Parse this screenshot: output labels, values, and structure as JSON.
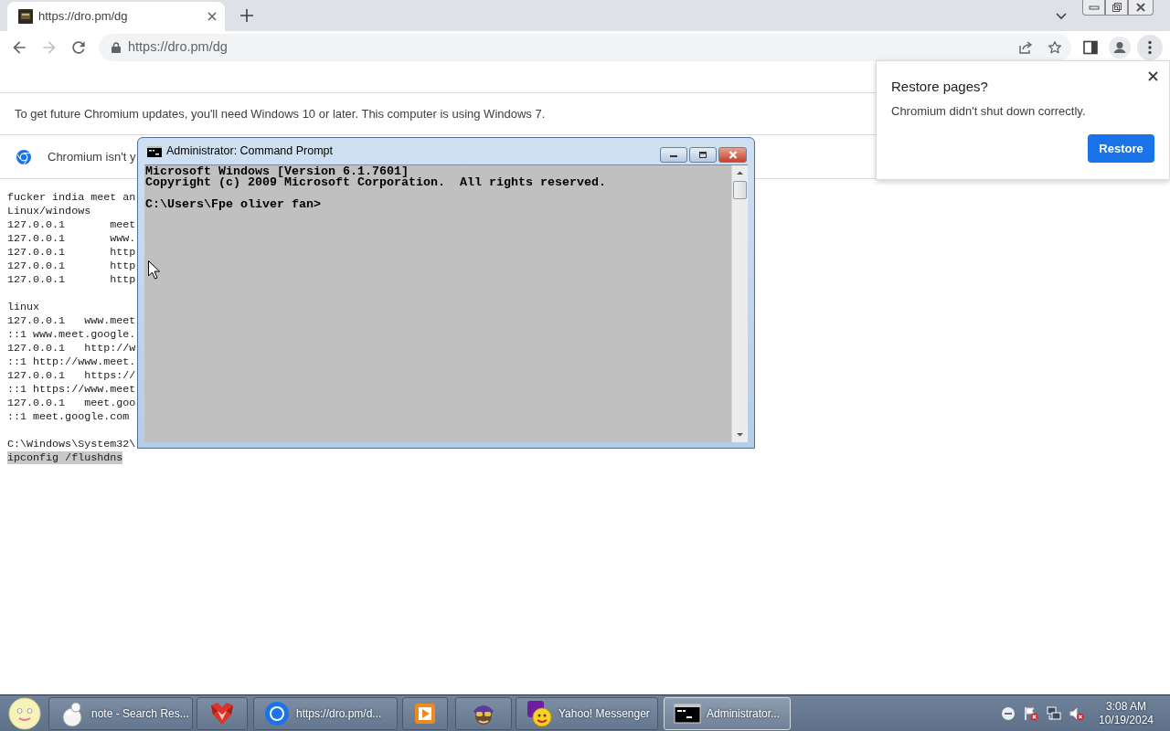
{
  "browser": {
    "tabs": [
      {
        "title": "https://dro.pm/dg",
        "selected": true
      }
    ],
    "toolbar": {
      "back": {
        "disabled": false
      },
      "forward": {
        "disabled": true
      },
      "address": "https://dro.pm/dg"
    },
    "infobars": [
      {
        "kind": "notice",
        "text": "To get future Chromium updates, you'll need Windows 10 or later. This computer is using Windows 7."
      },
      {
        "kind": "logo",
        "text": "Chromium isn't y"
      }
    ],
    "page_text": {
      "blocks": [
        {
          "lines": [
            {
              "text": "fucker india meet an",
              "selected": false
            },
            {
              "text": "Linux/windows",
              "selected": false
            },
            {
              "text": "127.0.0.1       meet",
              "selected": false
            },
            {
              "text": "127.0.0.1       www.",
              "selected": false
            },
            {
              "text": "127.0.0.1       http",
              "selected": false
            },
            {
              "text": "127.0.0.1       http",
              "selected": false
            },
            {
              "text": "127.0.0.1       http",
              "selected": false
            }
          ]
        },
        {
          "lines": [
            {
              "text": "linux",
              "selected": false
            },
            {
              "text": "127.0.0.1   www.meet",
              "selected": false
            },
            {
              "text": "::1 www.meet.google.",
              "selected": false
            },
            {
              "text": "127.0.0.1   http://w",
              "selected": false
            },
            {
              "text": "::1 http://www.meet.",
              "selected": false
            },
            {
              "text": "127.0.0.1   https://",
              "selected": false
            },
            {
              "text": "::1 https://www.meet",
              "selected": false
            },
            {
              "text": "127.0.0.1   meet.goo",
              "selected": false
            },
            {
              "text": "::1 meet.google.com",
              "selected": false
            }
          ]
        },
        {
          "lines": [
            {
              "text": "C:\\Windows\\System32\\",
              "selected": false
            },
            {
              "text": "ipconfig /flushdns",
              "selected": true
            }
          ]
        }
      ]
    },
    "restore_dialog": {
      "title": "Restore pages?",
      "message": "Chromium didn't shut down correctly.",
      "button": "Restore"
    }
  },
  "cmd_window": {
    "title": "Administrator: Command Prompt",
    "blocks": [
      [
        "Microsoft Windows [Version 6.1.7601]",
        "Copyright (c) 2009 Microsoft Corporation.  All rights reserved."
      ],
      [
        "C:\\Users\\Fpe oliver fan>"
      ]
    ]
  },
  "taskbar": {
    "buttons": [
      {
        "label": "note - Search Res...",
        "selected": false
      },
      {
        "selected": false
      },
      {
        "label": "https://dro.pm/d...",
        "selected": false
      },
      {
        "selected": false
      },
      {
        "selected": false
      },
      {
        "label": "Yahoo! Messenger",
        "selected": false
      },
      {
        "label": "Administrator...",
        "selected": true
      }
    ],
    "clock": {
      "time": "3:08 AM",
      "date": "10/19/2024"
    }
  }
}
